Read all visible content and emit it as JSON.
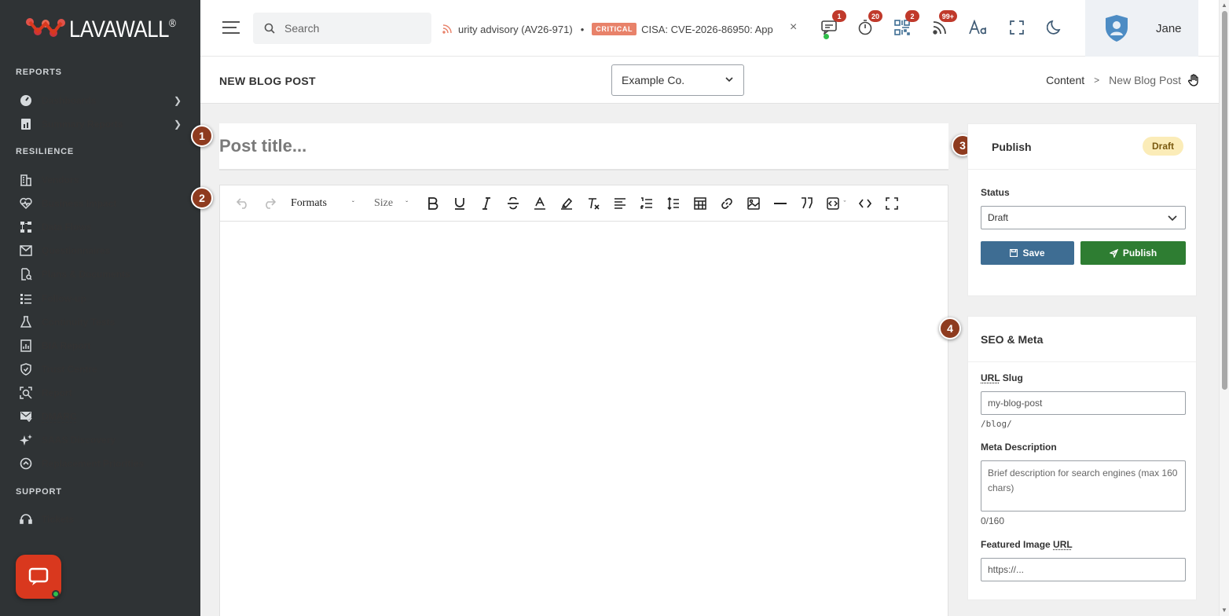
{
  "brand": {
    "name": "LAVAWALL",
    "reg": "®"
  },
  "sidebar": {
    "sections": [
      {
        "label": "REPORTS"
      },
      {
        "label": "RESILIENCE"
      },
      {
        "label": "SUPPORT"
      }
    ],
    "items": [
      {
        "label": "Dashboards",
        "icon": "gauge-icon"
      },
      {
        "label": "Summary Reports",
        "icon": "report-icon"
      },
      {
        "label": "Vendors",
        "icon": "building-icon"
      },
      {
        "label": "Business Impact",
        "icon": "heart-pulse-icon"
      },
      {
        "label": "Data Flows",
        "icon": "sitemap-icon"
      },
      {
        "label": "Questionnaires",
        "icon": "envelope-icon"
      },
      {
        "label": "Plans & Documents",
        "icon": "document-search-icon"
      },
      {
        "label": "Follow-up",
        "icon": "list-check-icon"
      },
      {
        "label": "Continuity Tests",
        "icon": "flask-icon"
      },
      {
        "label": "BIA Report",
        "icon": "chart-file-icon"
      },
      {
        "label": "Trust Centre",
        "icon": "shield-check-icon"
      },
      {
        "label": "Report",
        "icon": "magnify-report-icon"
      },
      {
        "label": "DMARC",
        "icon": "mail-check-icon"
      },
      {
        "label": "SAAS Discovery",
        "icon": "sparkles-icon"
      },
      {
        "label": "Replacement Priorities",
        "icon": "priority-icon"
      },
      {
        "label": "Tickets",
        "icon": "headset-icon"
      }
    ]
  },
  "topbar": {
    "search_placeholder": "Search",
    "ticker_text_1": "urity advisory (AV26-971)",
    "ticker_sep": "•",
    "ticker_badge": "CRITICAL",
    "ticker_text_2": "CISA: CVE-2026-86950: App",
    "close": "×",
    "badges": {
      "messages": "1",
      "timer": "20",
      "qr": "2",
      "feeds": "99+"
    },
    "user_name": "Jane",
    "colors": {
      "badge": "#c0392b",
      "online": "#2fbf4a"
    }
  },
  "subhead": {
    "title": "NEW BLOG POST",
    "org": "Example Co.",
    "breadcrumb_root": "Content",
    "breadcrumb_sep": ">",
    "breadcrumb_current": "New Blog Post"
  },
  "editor": {
    "title_placeholder": "Post title...",
    "formats": "Formats",
    "size": "Size"
  },
  "steps": [
    "1",
    "2",
    "3",
    "4"
  ],
  "publish": {
    "title": "Publish",
    "status_pill": "Draft",
    "status_label": "Status",
    "status_value": "Draft",
    "save": "Save",
    "publish": "Publish",
    "colors": {
      "save": "#3e6d93",
      "publish": "#2e7d32",
      "pill": "#fbecb8"
    }
  },
  "seo": {
    "title": "SEO & Meta",
    "slug_label_abbr": "URL",
    "slug_label_rest": " Slug",
    "slug_placeholder": "my-blog-post",
    "slug_prefix": "/blog/",
    "meta_label": "Meta Description",
    "meta_placeholder": "Brief description for search engines (max 160 chars)",
    "meta_count": "0/160",
    "image_label": "Featured Image ",
    "image_label_abbr": "URL",
    "image_placeholder": "https://..."
  },
  "accent_color": "#d9381e"
}
